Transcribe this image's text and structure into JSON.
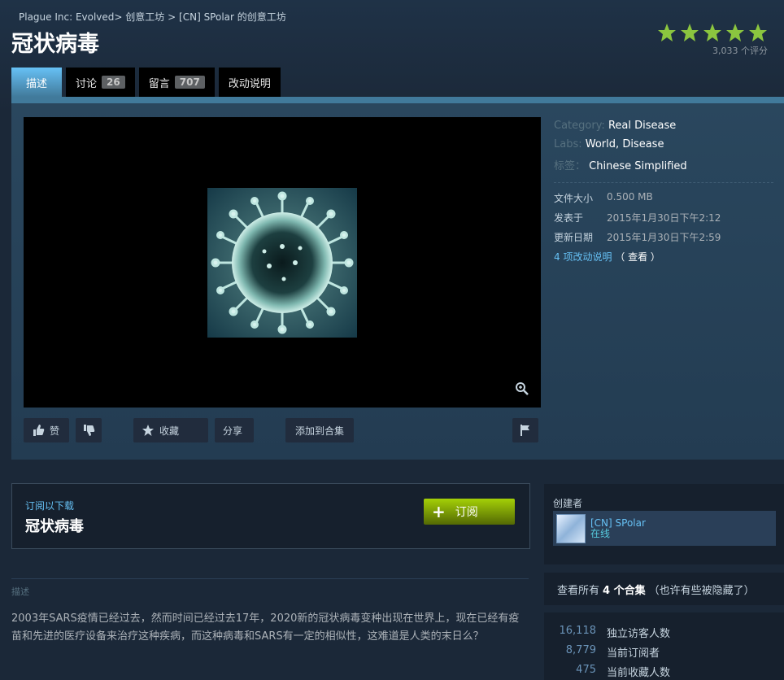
{
  "breadcrumb": {
    "game": "Plague Inc: Evolved",
    "sep1": ">",
    "workshop": "创意工坊",
    "sep2": ">",
    "author_workshop": "[CN] SPolar 的创意工坊"
  },
  "title": "冠状病毒",
  "rating": {
    "stars": 5,
    "count_text": "3,033 个评分"
  },
  "tabs": [
    {
      "label": "描述",
      "count": ""
    },
    {
      "label": "讨论",
      "count": "26"
    },
    {
      "label": "留言",
      "count": "707"
    },
    {
      "label": "改动说明",
      "count": ""
    }
  ],
  "actions": {
    "like": "赞",
    "favorite": "收藏",
    "share": "分享",
    "add_collection": "添加到合集"
  },
  "details": {
    "category_label": "Category:",
    "category_value": "Real Disease",
    "labs_label": "Labs:",
    "labs_value1": "World",
    "labs_sep": ",",
    "labs_value2": "Disease",
    "tags_label": "标签：",
    "tags_value": "Chinese Simplified",
    "size_label": "文件大小",
    "size_value": "0.500 MB",
    "posted_label": "发表于",
    "posted_value": "2015年1月30日下午2:12",
    "updated_label": "更新日期",
    "updated_value": "2015年1月30日下午2:59",
    "changes_link": "4 项改动说明",
    "changes_view": "（ 查看 ）"
  },
  "subscribe": {
    "hint": "订阅以下载",
    "title": "冠状病毒",
    "button": "订阅",
    "plus": "+"
  },
  "description": {
    "label": "描述",
    "body": "2003年SARS疫情已经过去，然而时间已经过去17年，2020新的冠状病毒变种出现在世界上，现在已经有疫苗和先进的医疗设备来治疗这种疾病，而这种病毒和SARS有一定的相似性，这难道是人类的末日么？"
  },
  "creator": {
    "label": "创建者",
    "name": "[CN] SPolar",
    "status": "在线"
  },
  "collections": {
    "prefix": "查看所有",
    "count": "4 个合集",
    "suffix": "（也许有些被隐藏了）"
  },
  "stats": [
    {
      "value": "16,118",
      "label": "独立访客人数"
    },
    {
      "value": "8,779",
      "label": "当前订阅者"
    },
    {
      "value": "475",
      "label": "当前收藏人数"
    }
  ],
  "colors": {
    "accent": "#66c0f4",
    "star": "#8bc53f",
    "subscribe_green": "#a4d007"
  }
}
